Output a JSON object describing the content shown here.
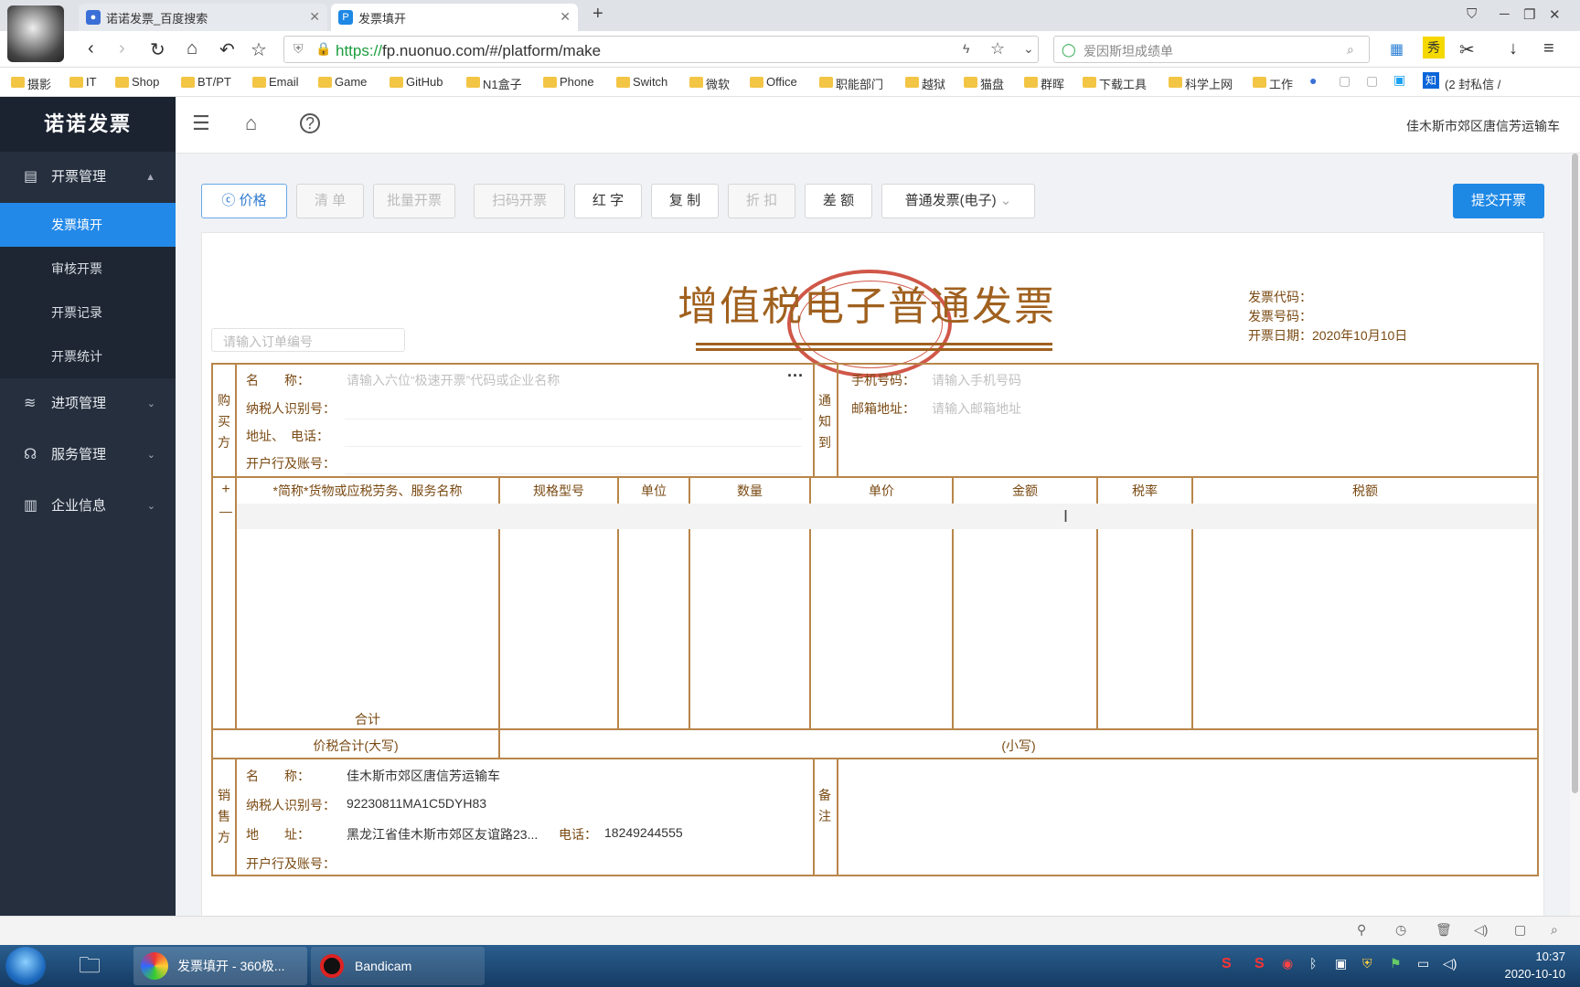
{
  "browser": {
    "tabs": [
      {
        "title": "诺诺发票_百度搜索"
      },
      {
        "title": "发票填开"
      }
    ],
    "url": "https://fp.nuonuo.com/#/platform/make",
    "url_scheme": "https://",
    "url_rest": "fp.nuonuo.com/#/platform/make",
    "search_text": "爱因斯坦成绩单",
    "bookmarks": [
      "摄影",
      "IT",
      "Shop",
      "BT/PT",
      "Email",
      "Game",
      "GitHub",
      "N1盒子",
      "Phone",
      "Switch",
      "微软",
      "Office",
      "职能部门",
      "越狱",
      "猫盘",
      "群晖",
      "下载工具",
      "科学上网",
      "工作",
      "(2 封私信 /"
    ]
  },
  "app": {
    "logo": "诺诺发票",
    "company": "佳木斯市郊区唐信芳运输车",
    "sidebar": {
      "group1": "开票管理",
      "sub_items": [
        "发票填开",
        "审核开票",
        "开票记录",
        "开票统计"
      ],
      "groups": [
        "进项管理",
        "服务管理",
        "企业信息"
      ]
    },
    "toolbar": {
      "price": "价格",
      "list": "清 单",
      "batch": "批量开票",
      "scan": "扫码开票",
      "red": "红 字",
      "copy": "复 制",
      "discount": "折 扣",
      "diff": "差 额",
      "invoice_type": "普通发票(电子)",
      "submit": "提交开票"
    },
    "invoice": {
      "title": "增值税电子普通发票",
      "code_label": "发票代码：",
      "number_label": "发票号码：",
      "date_label": "开票日期：",
      "date_value": "2020年10月10日",
      "order_placeholder": "请输入订单编号",
      "buyer_side": "购买方",
      "buyer": {
        "name_label": "名　　称：",
        "name_placeholder": "请输入六位“极速开票”代码或企业名称",
        "tax_label": "纳税人识别号：",
        "addr_label": "地址、　电话：",
        "bank_label": "开户行及账号："
      },
      "notify_side": "通知到",
      "notify": {
        "phone_label": "手机号码：",
        "phone_placeholder": "请输入手机号码",
        "email_label": "邮箱地址：",
        "email_placeholder": "请输入邮箱地址"
      },
      "columns": [
        "*简称*货物或应税劳务、服务名称",
        "规格型号",
        "单位",
        "数量",
        "单价",
        "金额",
        "税率",
        "税额"
      ],
      "add_row": "+",
      "remove_row": "—",
      "total_label": "合计",
      "total_caps_label": "价税合计(大写)",
      "total_small_label": "(小写)",
      "seller_side": "销售方",
      "seller": {
        "name_label": "名　　称：",
        "name_value": "佳木斯市郊区唐信芳运输车",
        "tax_label": "纳税人识别号：",
        "tax_value": "92230811MA1C5DYH83",
        "addr_label": "地　　址：",
        "addr_value": "黑龙江省佳木斯市郊区友谊路23...",
        "phone_label": "电话：",
        "phone_value": "18249244555",
        "bank_label": "开户行及账号："
      },
      "remark_side": "备注"
    }
  },
  "taskbar": {
    "items": [
      "发票填开 - 360极...",
      "Bandicam"
    ],
    "time": "10:37",
    "date": "2020-10-10"
  }
}
